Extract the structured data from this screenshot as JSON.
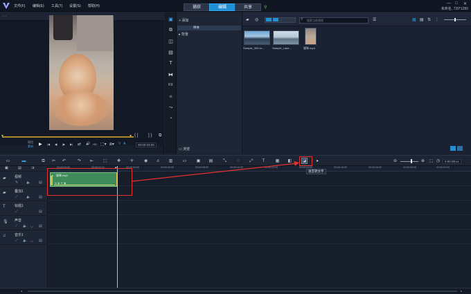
{
  "app": {
    "menu": [
      "文件(F)",
      "编辑(E)",
      "工具(T)",
      "设置(S)",
      "帮助(H)"
    ],
    "mode_tabs": [
      "捕获",
      "编辑",
      "共享"
    ],
    "active_tab": "编辑",
    "project_info": "未命名, 720*1280",
    "window_controls": [
      "—",
      "□",
      "✕"
    ]
  },
  "preview": {
    "project_label": "项目",
    "clip_label": "素材",
    "timecode": "00:00:03:00",
    "ctrl_icons": {
      "play": "▶",
      "prev": "|◀",
      "back": "◀|",
      "fwd": "|▶",
      "next": "▶|",
      "repeat": "⇄",
      "volume": "🔊",
      "hd": "HD"
    }
  },
  "library": {
    "add_label": "添加",
    "folders": [
      "样本",
      "背景"
    ],
    "browse_label": "浏览",
    "search_placeholder": "搜索当前视图",
    "media": [
      {
        "label": "Sample_300.m..."
      },
      {
        "label": "Sample_Lake..."
      },
      {
        "label": "猫咪.mp4"
      }
    ]
  },
  "timeline": {
    "ruler_ticks": [
      "00:00:00:00",
      "00:00:02:00",
      "00:00:04:00",
      "00:00:06:00",
      "00:00:08:00",
      "00:00:10:00",
      "00:00:12:00",
      "00:00:14:00",
      "00:00:16:00",
      "00:00:18:00",
      "00:00:20:00",
      "00:00:22:00"
    ],
    "timecode": "0:00:09:xx",
    "tracks": [
      {
        "name": "视频"
      },
      {
        "name": "叠加1"
      },
      {
        "name": "标题1"
      },
      {
        "name": "声音"
      },
      {
        "name": "音乐1"
      }
    ],
    "clip_name": "猫咪.mp4",
    "tooltip": "语音转文字"
  },
  "colors": {
    "accent": "#1f8fd8",
    "clip": "#3f8b5a",
    "annotation": "#e8322e"
  }
}
